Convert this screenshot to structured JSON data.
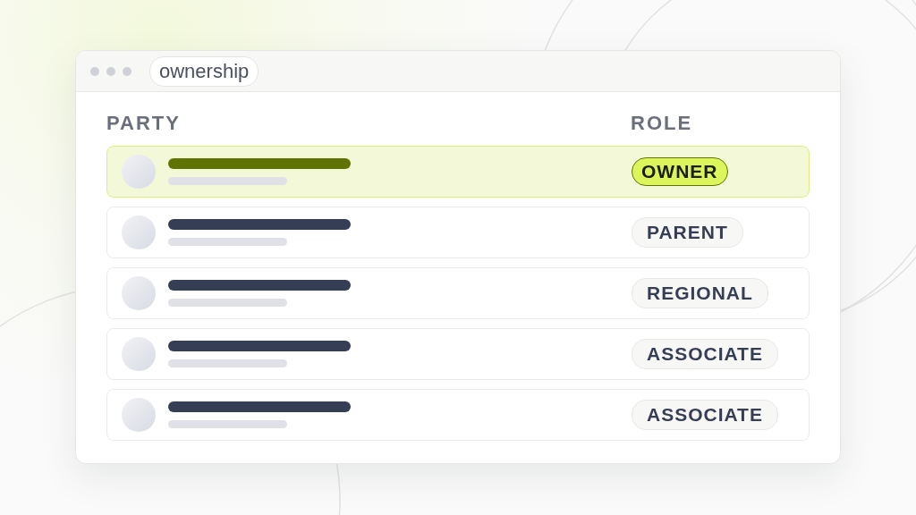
{
  "window": {
    "title": "ownership"
  },
  "table": {
    "columns": [
      "PARTY",
      "ROLE"
    ],
    "rows": [
      {
        "role": "OWNER",
        "selected": true
      },
      {
        "role": "PARENT",
        "selected": false
      },
      {
        "role": "REGIONAL",
        "selected": false
      },
      {
        "role": "ASSOCIATE",
        "selected": false
      },
      {
        "role": "ASSOCIATE",
        "selected": false
      }
    ]
  }
}
